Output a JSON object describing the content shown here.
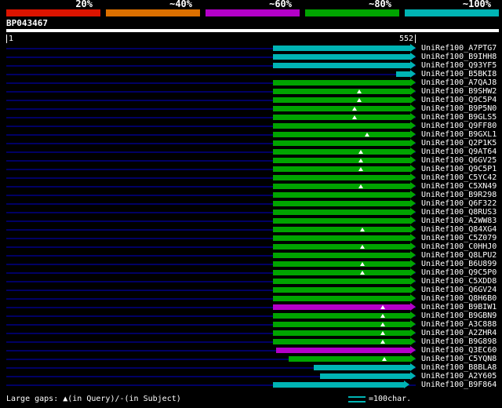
{
  "palette": {
    "red": "#dc1400",
    "orange": "#dc7000",
    "purple": "#b400c8",
    "green": "#00a400",
    "cyan": "#00b4b4"
  },
  "query_ruler": {
    "start": "1",
    "end": "552"
  },
  "legend": {
    "gaps_label": "Large gaps: ▲(in Query)/-(in Subject)",
    "scale_label": "=100char.",
    "scale_glyph_color": "#00b4b4"
  },
  "chart_data": {
    "type": "bar",
    "subtype": "blast-alignment-overview",
    "orientation": "horizontal",
    "title": "BP043467",
    "query": {
      "name": "BP043467",
      "length": 552
    },
    "x_axis": {
      "label": "query position",
      "min": 1,
      "max": 552,
      "grid": false
    },
    "identity_scale": [
      {
        "label": "20%",
        "color": "red"
      },
      {
        "label": "~40%",
        "color": "orange"
      },
      {
        "label": "~60%",
        "color": "purple"
      },
      {
        "label": "~80%",
        "color": "green"
      },
      {
        "label": "~100%",
        "color": "cyan"
      }
    ],
    "hits": [
      {
        "id": "UniRef100_A7PTG7",
        "from": 360,
        "to": 552,
        "color": "cyan",
        "gaps": []
      },
      {
        "id": "UniRef100_B9IHH8",
        "from": 360,
        "to": 552,
        "color": "cyan",
        "gaps": []
      },
      {
        "id": "UniRef100_Q93YF5",
        "from": 360,
        "to": 552,
        "color": "cyan",
        "gaps": []
      },
      {
        "id": "UniRef100_B5BKI8",
        "from": 526,
        "to": 552,
        "color": "cyan",
        "gaps": []
      },
      {
        "id": "UniRef100_A7QAJ8",
        "from": 360,
        "to": 552,
        "color": "green",
        "gaps": []
      },
      {
        "id": "UniRef100_B9SHW2",
        "from": 360,
        "to": 552,
        "color": "green",
        "gaps": [
          476
        ]
      },
      {
        "id": "UniRef100_Q9C5P4",
        "from": 360,
        "to": 552,
        "color": "green",
        "gaps": [
          476
        ]
      },
      {
        "id": "UniRef100_B9P5N0",
        "from": 360,
        "to": 552,
        "color": "green",
        "gaps": [
          470
        ]
      },
      {
        "id": "UniRef100_B9GLS5",
        "from": 360,
        "to": 552,
        "color": "green",
        "gaps": [
          470
        ]
      },
      {
        "id": "UniRef100_Q9FF80",
        "from": 360,
        "to": 552,
        "color": "green",
        "gaps": []
      },
      {
        "id": "UniRef100_B9GXL1",
        "from": 360,
        "to": 552,
        "color": "green",
        "gaps": [
          487
        ]
      },
      {
        "id": "UniRef100_Q2P1K5",
        "from": 360,
        "to": 552,
        "color": "green",
        "gaps": []
      },
      {
        "id": "UniRef100_Q9AT64",
        "from": 360,
        "to": 552,
        "color": "green",
        "gaps": [
          478
        ]
      },
      {
        "id": "UniRef100_Q6GV25",
        "from": 360,
        "to": 552,
        "color": "green",
        "gaps": [
          478
        ]
      },
      {
        "id": "UniRef100_Q9C5P1",
        "from": 360,
        "to": 552,
        "color": "green",
        "gaps": [
          478
        ]
      },
      {
        "id": "UniRef100_C5YC42",
        "from": 360,
        "to": 552,
        "color": "green",
        "gaps": []
      },
      {
        "id": "UniRef100_C5XN49",
        "from": 360,
        "to": 552,
        "color": "green",
        "gaps": [
          478
        ]
      },
      {
        "id": "UniRef100_B9R298",
        "from": 360,
        "to": 552,
        "color": "green",
        "gaps": []
      },
      {
        "id": "UniRef100_Q6F322",
        "from": 360,
        "to": 552,
        "color": "green",
        "gaps": []
      },
      {
        "id": "UniRef100_Q8RUS3",
        "from": 360,
        "to": 552,
        "color": "green",
        "gaps": []
      },
      {
        "id": "UniRef100_A2WW83",
        "from": 360,
        "to": 552,
        "color": "green",
        "gaps": []
      },
      {
        "id": "UniRef100_Q84XG4",
        "from": 360,
        "to": 552,
        "color": "green",
        "gaps": [
          480
        ]
      },
      {
        "id": "UniRef100_C5Z079",
        "from": 360,
        "to": 552,
        "color": "green",
        "gaps": []
      },
      {
        "id": "UniRef100_C0HHJ0",
        "from": 360,
        "to": 552,
        "color": "green",
        "gaps": [
          480
        ]
      },
      {
        "id": "UniRef100_Q8LPU2",
        "from": 360,
        "to": 552,
        "color": "green",
        "gaps": []
      },
      {
        "id": "UniRef100_B6U899",
        "from": 360,
        "to": 552,
        "color": "green",
        "gaps": [
          480
        ]
      },
      {
        "id": "UniRef100_Q9C5P0",
        "from": 360,
        "to": 552,
        "color": "green",
        "gaps": [
          480
        ]
      },
      {
        "id": "UniRef100_C5XDD8",
        "from": 360,
        "to": 552,
        "color": "green",
        "gaps": []
      },
      {
        "id": "UniRef100_Q6GV24",
        "from": 360,
        "to": 552,
        "color": "green",
        "gaps": []
      },
      {
        "id": "UniRef100_Q8H6B0",
        "from": 360,
        "to": 552,
        "color": "green",
        "gaps": []
      },
      {
        "id": "UniRef100_B9BIW1",
        "from": 360,
        "to": 552,
        "color": "purple",
        "gaps": [
          508
        ]
      },
      {
        "id": "UniRef100_B9GBN9",
        "from": 360,
        "to": 552,
        "color": "green",
        "gaps": [
          508
        ]
      },
      {
        "id": "UniRef100_A3C888",
        "from": 360,
        "to": 552,
        "color": "green",
        "gaps": [
          508
        ]
      },
      {
        "id": "UniRef100_A2ZHR4",
        "from": 360,
        "to": 552,
        "color": "green",
        "gaps": [
          508
        ]
      },
      {
        "id": "UniRef100_B9G898",
        "from": 360,
        "to": 552,
        "color": "green",
        "gaps": [
          508
        ]
      },
      {
        "id": "UniRef100_Q3EC60",
        "from": 364,
        "to": 552,
        "color": "purple",
        "gaps": []
      },
      {
        "id": "UniRef100_C5YQN8",
        "from": 381,
        "to": 552,
        "color": "green",
        "gaps": [
          510
        ]
      },
      {
        "id": "UniRef100_B8BLA8",
        "from": 415,
        "to": 552,
        "color": "cyan",
        "gaps": []
      },
      {
        "id": "UniRef100_A2Y605",
        "from": 423,
        "to": 552,
        "color": "cyan",
        "gaps": []
      },
      {
        "id": "UniRef100_B9F864",
        "from": 360,
        "to": 544,
        "color": "cyan",
        "gaps": []
      }
    ]
  }
}
